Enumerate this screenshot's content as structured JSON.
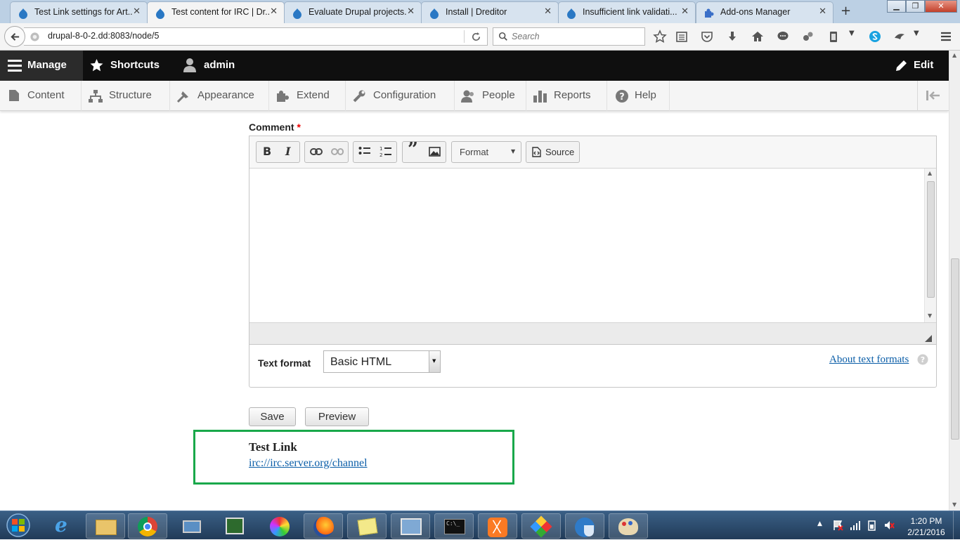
{
  "browser": {
    "tabs": [
      {
        "title": "Test Link settings for Art..."
      },
      {
        "title": "Test content for IRC | Dr..."
      },
      {
        "title": "Evaluate Drupal projects..."
      },
      {
        "title": "Install | Dreditor"
      },
      {
        "title": "Insufficient link validati..."
      },
      {
        "title": "Add-ons Manager"
      }
    ],
    "tab_close": "✕",
    "new_tab": "+",
    "url": "drupal-8-0-2.dd:8083/node/5",
    "search_placeholder": "Search"
  },
  "toolbar": {
    "manage": "Manage",
    "shortcuts": "Shortcuts",
    "user": "admin",
    "edit": "Edit"
  },
  "tray": {
    "items": [
      {
        "label": "Content",
        "icon": "content-icon"
      },
      {
        "label": "Structure",
        "icon": "structure-icon"
      },
      {
        "label": "Appearance",
        "icon": "appearance-icon"
      },
      {
        "label": "Extend",
        "icon": "extend-icon"
      },
      {
        "label": "Configuration",
        "icon": "configuration-icon"
      },
      {
        "label": "People",
        "icon": "people-icon"
      },
      {
        "label": "Reports",
        "icon": "reports-icon"
      },
      {
        "label": "Help",
        "icon": "help-icon"
      }
    ]
  },
  "form": {
    "comment_label": "Comment",
    "required_marker": "*",
    "format_button": "Format",
    "source_button": "Source",
    "text_format_label": "Text format",
    "text_format_value": "Basic HTML",
    "about_text_formats": "About text formats",
    "save": "Save",
    "preview": "Preview"
  },
  "test_link": {
    "title": "Test Link",
    "url": "irc://irc.server.org/channel"
  },
  "taskbar": {
    "time": "1:20 PM",
    "date": "2/21/2016"
  },
  "colors": {
    "highlight": "#19a84a",
    "link": "#0b5ea8",
    "toolbar": "#0f0f0f"
  }
}
